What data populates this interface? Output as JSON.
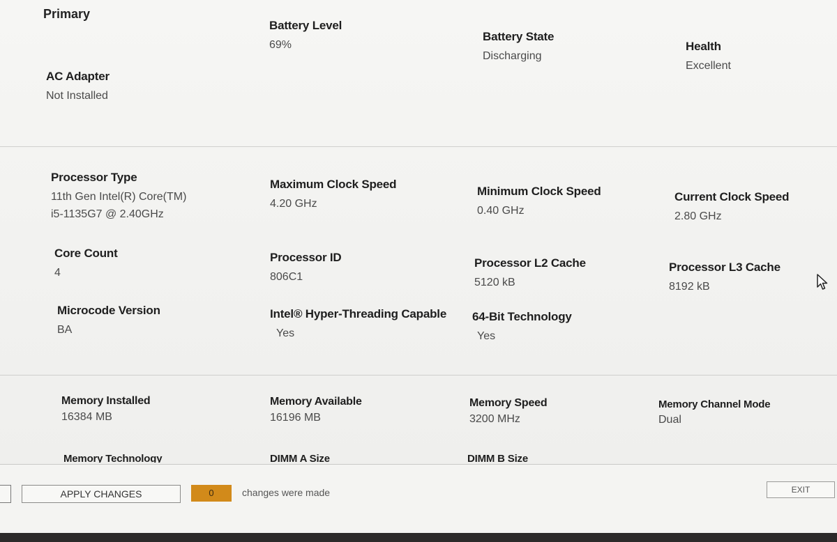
{
  "battery": {
    "section_title": "Primary",
    "fields": [
      {
        "label": "Battery Level",
        "value": "69%"
      },
      {
        "label": "Battery State",
        "value": "Discharging"
      },
      {
        "label": "Health",
        "value": "Excellent"
      },
      {
        "label": "AC Adapter",
        "value": "Not Installed"
      }
    ]
  },
  "processor": {
    "fields": [
      {
        "label": "Processor Type",
        "value_line1": "11th Gen Intel(R) Core(TM)",
        "value_line2": "i5-1135G7 @ 2.40GHz"
      },
      {
        "label": "Maximum Clock Speed",
        "value": "4.20 GHz"
      },
      {
        "label": "Minimum Clock Speed",
        "value": "0.40 GHz"
      },
      {
        "label": "Current Clock Speed",
        "value": "2.80 GHz"
      },
      {
        "label": "Core Count",
        "value": "4"
      },
      {
        "label": "Processor ID",
        "value": "806C1"
      },
      {
        "label": "Processor L2 Cache",
        "value": "5120 kB"
      },
      {
        "label": "Processor L3 Cache",
        "value": "8192 kB"
      },
      {
        "label": "Microcode Version",
        "value": "BA"
      },
      {
        "label": "Intel® Hyper-Threading Capable",
        "value": "Yes"
      },
      {
        "label": "64-Bit Technology",
        "value": "Yes"
      }
    ]
  },
  "memory": {
    "fields": [
      {
        "label": "Memory Installed",
        "value": "16384 MB"
      },
      {
        "label": "Memory Available",
        "value": "16196 MB"
      },
      {
        "label": "Memory Speed",
        "value": "3200 MHz"
      },
      {
        "label": "Memory Channel Mode",
        "value": "Dual"
      }
    ],
    "clipped_labels": [
      "Memory Technology",
      "DIMM A Size",
      "DIMM B Size"
    ]
  },
  "footer": {
    "apply_label": "APPLY CHANGES",
    "change_count": "0",
    "change_text": "changes were made",
    "exit_label": "EXIT"
  },
  "colors": {
    "accent_orange": "#d28a1a",
    "background": "#f3f3f1",
    "bezel": "#2c2a2a"
  },
  "icons": [
    "mouse-cursor-icon"
  ]
}
